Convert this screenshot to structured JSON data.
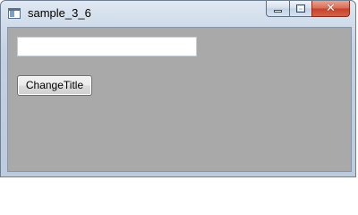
{
  "window": {
    "title": "sample_3_6",
    "client_background": "#a9a9a9"
  },
  "caption_buttons": {
    "minimize_icon": "minimize-icon",
    "maximize_icon": "maximize-icon",
    "close_icon": "close-icon",
    "close_glyph": "✕"
  },
  "form": {
    "textbox_value": "",
    "button_label": "ChangeTitle"
  }
}
